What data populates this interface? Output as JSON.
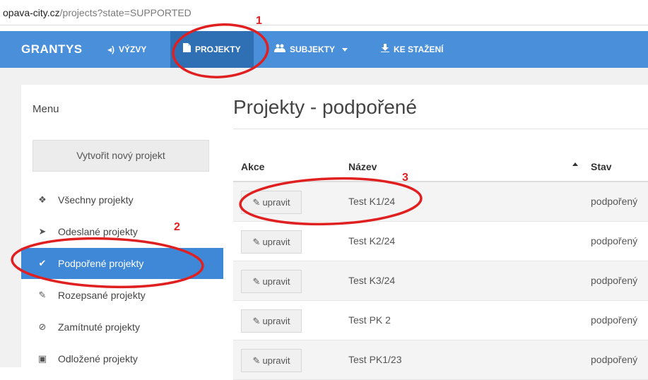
{
  "browser": {
    "url_host": "opava-city.cz",
    "url_path": "/projects?state=SUPPORTED"
  },
  "navbar": {
    "brand": "GRANTYS",
    "items": [
      {
        "label": "VÝZVY",
        "icon": "megaphone-icon"
      },
      {
        "label": "PROJEKTY",
        "icon": "file-icon",
        "active": true
      },
      {
        "label": "SUBJEKTY",
        "icon": "users-icon",
        "dropdown": true
      },
      {
        "label": "KE STAŽENÍ",
        "icon": "download-icon"
      }
    ]
  },
  "sidebar": {
    "title": "Menu",
    "new_button": "Vytvořit nový projekt",
    "items": [
      {
        "label": "Všechny projekty",
        "icon": "cubes-icon"
      },
      {
        "label": "Odeslané projekty",
        "icon": "paper-plane-icon"
      },
      {
        "label": "Podpořené projekty",
        "icon": "check-icon",
        "active": true
      },
      {
        "label": "Rozepsané projekty",
        "icon": "pencil-icon"
      },
      {
        "label": "Zamítnuté projekty",
        "icon": "ban-icon"
      },
      {
        "label": "Odložené projekty",
        "icon": "archive-icon"
      }
    ]
  },
  "main": {
    "title": "Projekty - podpořené",
    "columns": [
      "Akce",
      "Název",
      "Stav"
    ],
    "edit_label": "upravit",
    "rows": [
      {
        "name": "Test K1/24",
        "state": "podpořený"
      },
      {
        "name": "Test K2/24",
        "state": "podpořený"
      },
      {
        "name": "Test K3/24",
        "state": "podpořený"
      },
      {
        "name": "Test PK 2",
        "state": "podpořený"
      },
      {
        "name": "Test PK1/23",
        "state": "podpořený"
      }
    ]
  },
  "annotations": {
    "numbers": [
      "1",
      "2",
      "3"
    ],
    "color": "#e02020"
  },
  "colors": {
    "navbar": "#4a8fd9",
    "navbar_active": "#2f6fb3",
    "sidebar_active": "#3f88d8"
  }
}
